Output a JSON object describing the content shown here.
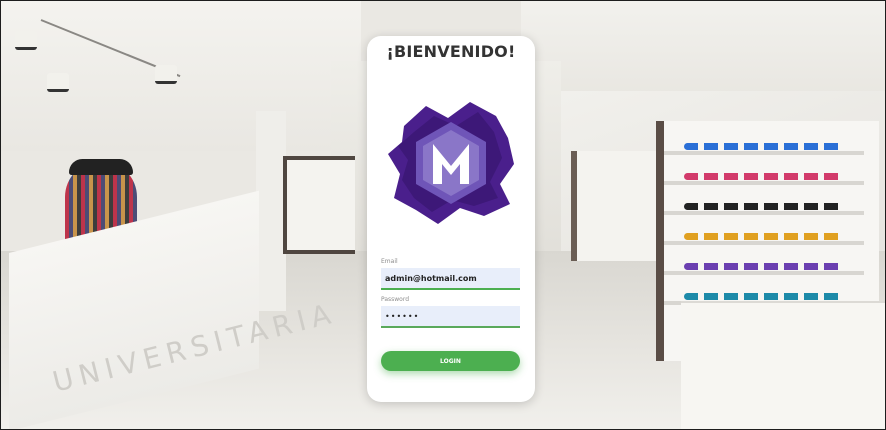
{
  "login": {
    "title": "¡BIENVENIDO!",
    "email_label": "Email",
    "email_value": "admin@hotmail.com",
    "password_label": "Password",
    "password_value": "••••••",
    "login_button": "LOGIN"
  },
  "store": {
    "counter_text": "UNIVERSITARIA"
  },
  "colors": {
    "accent": "#4caf50",
    "logo_purple": "#4a1f8c",
    "card_bg": "#ffffff"
  },
  "icons": {
    "logo": "m-hexagon-logo"
  }
}
